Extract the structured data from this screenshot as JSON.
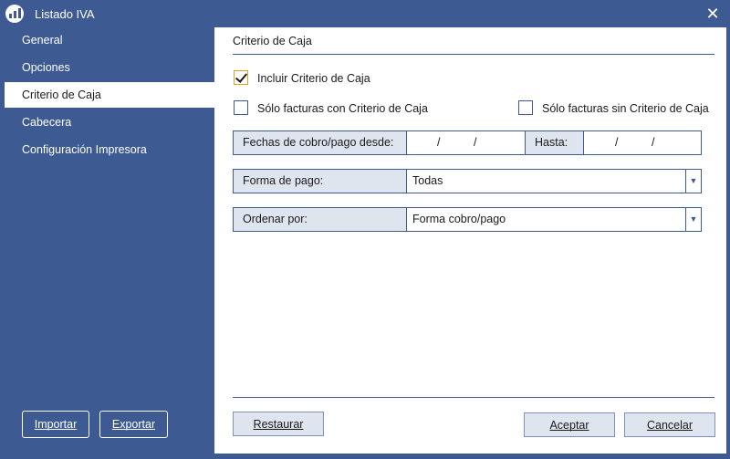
{
  "window": {
    "title": "Listado IVA",
    "close_symbol": "✕"
  },
  "sidebar": {
    "items": [
      {
        "label": "General",
        "active": false
      },
      {
        "label": "Opciones",
        "active": false
      },
      {
        "label": "Criterio de Caja",
        "active": true
      },
      {
        "label": "Cabecera",
        "active": false
      },
      {
        "label": "Configuración Impresora",
        "active": false
      }
    ],
    "import_label": "Importar",
    "export_label": "Exportar"
  },
  "main": {
    "section_title": "Criterio de Caja",
    "include_checkbox": {
      "label": "Incluir Criterio de Caja",
      "checked": true
    },
    "only_with_checkbox": {
      "label": "Sólo facturas con Criterio de Caja",
      "checked": false
    },
    "only_without_checkbox": {
      "label": "Sólo facturas sin Criterio de Caja",
      "checked": false
    },
    "date_range": {
      "label": "Fechas de cobro/pago desde:",
      "from_value": "/ /",
      "to_label": "Hasta:",
      "to_value": "/ /",
      "separator": "/"
    },
    "payment_method": {
      "label": "Forma de pago:",
      "value": "Todas"
    },
    "order_by": {
      "label": "Ordenar por:",
      "value": "Forma cobro/pago"
    },
    "restore_label": "Restaurar",
    "accept_label": "Aceptar",
    "cancel_label": "Cancelar"
  },
  "colors": {
    "accent": "#3d5a92",
    "panel": "#ffffff",
    "label_bg": "#dfe5ef",
    "check_border": "#d9a21a"
  }
}
